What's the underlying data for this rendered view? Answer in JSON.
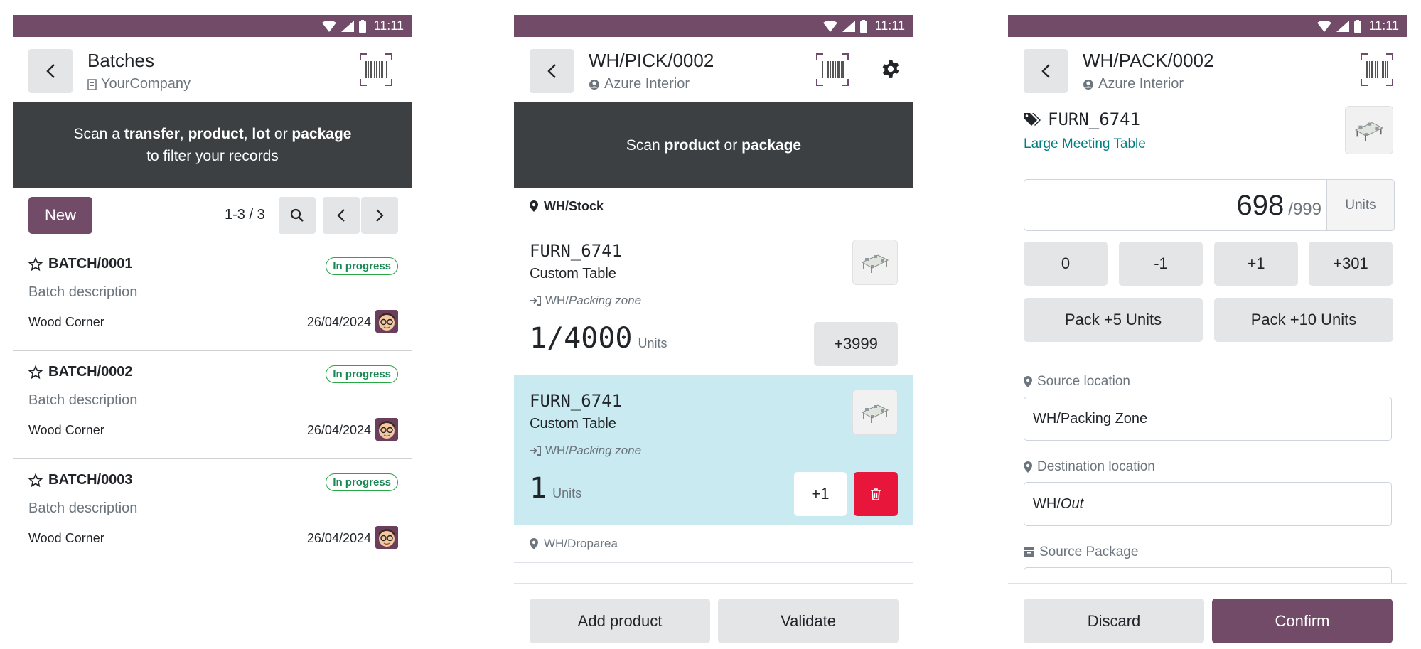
{
  "status_bar": {
    "time": "11:11"
  },
  "screen_batches": {
    "title": "Batches",
    "company": "YourCompany",
    "scan_banner": {
      "prefix": "Scan a ",
      "b1": "transfer",
      "sep1": ", ",
      "b2": "product",
      "sep2": ", ",
      "b3": "lot",
      "sep3": " or ",
      "b4": "package",
      "line2": "to filter your records"
    },
    "new_label": "New",
    "pager": "1-3 / 3",
    "batches": [
      {
        "name": "BATCH/0001",
        "status": "In progress",
        "description": "Batch description",
        "company": "Wood Corner",
        "date": "26/04/2024"
      },
      {
        "name": "BATCH/0002",
        "status": "In progress",
        "description": "Batch description",
        "company": "Wood Corner",
        "date": "26/04/2024"
      },
      {
        "name": "BATCH/0003",
        "status": "In progress",
        "description": "Batch description",
        "company": "Wood Corner",
        "date": "26/04/2024"
      }
    ]
  },
  "screen_picking": {
    "title": "WH/PICK/0002",
    "partner": "Azure Interior",
    "scan_banner": {
      "prefix": "Scan ",
      "b1": "product",
      "sep": " or ",
      "b2": "package"
    },
    "location": "WH/Stock",
    "lines": [
      {
        "code": "FURN_6741",
        "product": "Custom Table",
        "zone_prefix": "WH/",
        "zone": "Packing zone",
        "qty": "1/4000",
        "unit": "Units",
        "action": "+3999"
      },
      {
        "code": "FURN_6741",
        "product": "Custom Table",
        "zone_prefix": "WH/",
        "zone": "Packing zone",
        "qty": "1",
        "unit": "Units",
        "action": "+1"
      }
    ],
    "location2": "WH/Droparea",
    "add_product": "Add product",
    "validate": "Validate"
  },
  "screen_pack": {
    "title": "WH/PACK/0002",
    "partner": "Azure Interior",
    "product_code": "FURN_6741",
    "product_name": "Large Meeting Table",
    "qty_done": "698",
    "qty_demand": "/999",
    "unit": "Units",
    "qty_buttons": [
      "0",
      "-1",
      "+1",
      "+301"
    ],
    "pack_buttons": [
      "Pack +5 Units",
      "Pack +10 Units"
    ],
    "source_location_label": "Source location",
    "source_location_value": "WH/Packing Zone",
    "destination_location_label": "Destination location",
    "destination_prefix": "WH/",
    "destination_value": "Out",
    "source_package_label": "Source Package",
    "discard": "Discard",
    "confirm": "Confirm"
  },
  "colors": {
    "brand": "#714b67",
    "banner": "#3c4043",
    "selected_line": "#c8eaf0",
    "success": "#28a745",
    "danger": "#e9163b",
    "link": "#017e84"
  }
}
